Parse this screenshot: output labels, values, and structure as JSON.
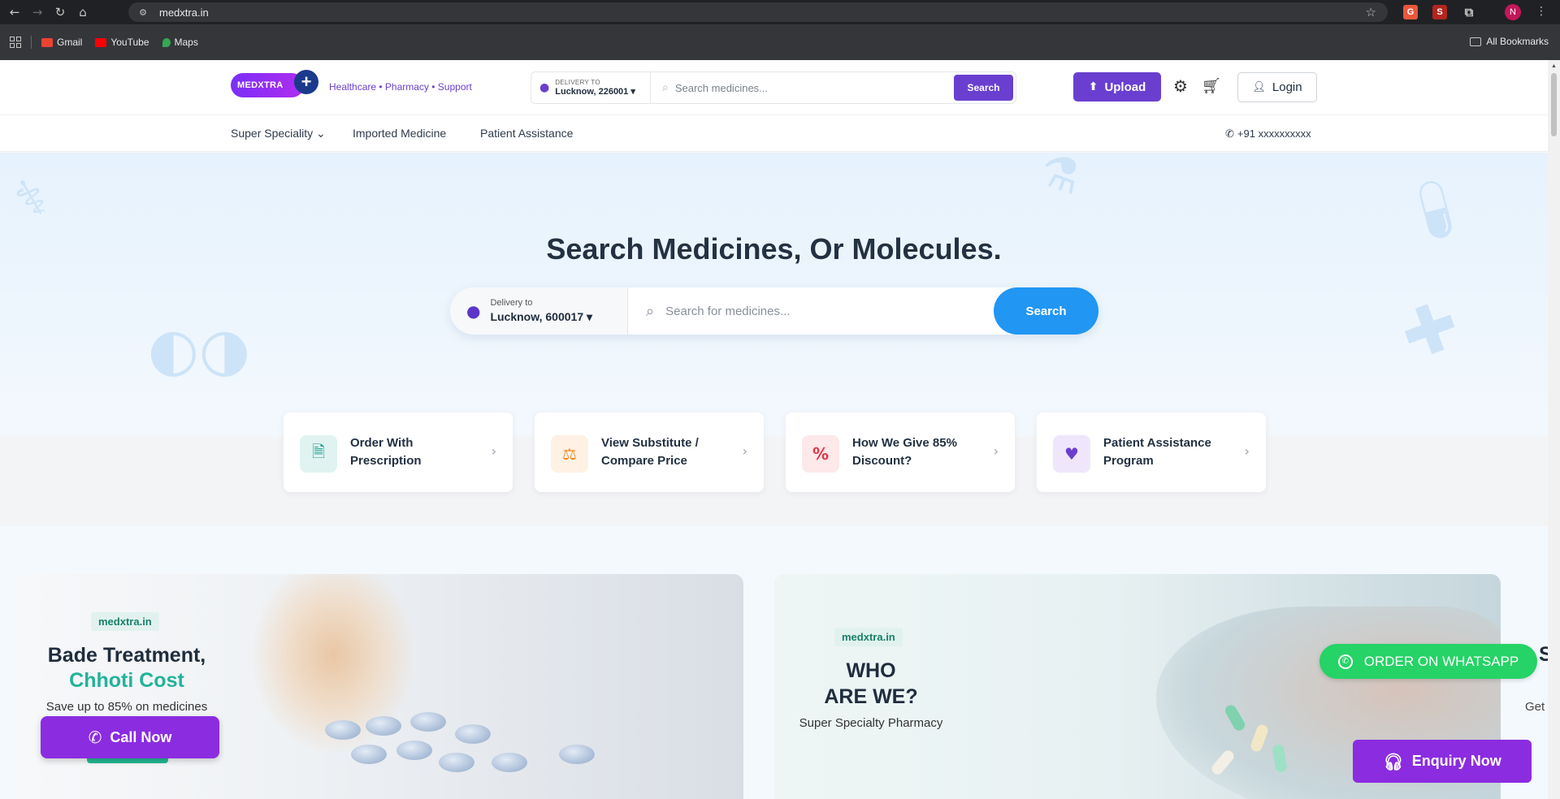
{
  "browser": {
    "url": "medxtra.in",
    "profile_initial": "N",
    "bookmarks": [
      {
        "label": "Gmail",
        "icon": "gmail-icon",
        "color": "#ea4335"
      },
      {
        "label": "YouTube",
        "icon": "youtube-icon",
        "color": "#ff0000"
      },
      {
        "label": "Maps",
        "icon": "maps-icon",
        "color": "#34a853"
      }
    ],
    "all_bookmarks": "All Bookmarks"
  },
  "header": {
    "logo_text": "MEDXTRA",
    "tagline": "Healthcare • Pharmacy • Support",
    "delivery_label": "DELIVERY TO",
    "delivery_value": "Lucknow, 226001 ▾",
    "search_placeholder": "Search medicines...",
    "search_button": "Search",
    "upload_button": "Upload",
    "login_button": "Login"
  },
  "subnav": {
    "items": [
      "Super Speciality ⌄",
      "Imported Medicine",
      "Patient Assistance"
    ],
    "phone": "+91 xxxxxxxxxx"
  },
  "hero": {
    "title": "Search Medicines, Or Molecules.",
    "delivery_label": "Delivery to",
    "delivery_value": "Lucknow, 600017 ▾",
    "search_placeholder": "Search for medicines...",
    "search_button": "Search"
  },
  "quick_links": [
    {
      "label": "Order With Prescription",
      "icon": "prescription-icon",
      "bg": "#e0f3f1",
      "color": "#159a86"
    },
    {
      "label": "View Substitute / Compare Price",
      "icon": "scale-icon",
      "bg": "#fff1e3",
      "color": "#f08a24"
    },
    {
      "label": "How We Give 85% Discount?",
      "icon": "percent-icon",
      "bg": "#fde8ea",
      "color": "#e0394a"
    },
    {
      "label": "Patient Assistance Program",
      "icon": "hand-heart-icon",
      "bg": "#efe6fb",
      "color": "#6a3fd0"
    }
  ],
  "banner_left": {
    "tag": "medxtra.in",
    "title_line1": "Bade Treatment,",
    "title_line2": "Chhoti Cost",
    "subtitle": "Save up to 85% on medicines",
    "call_button": "Call Now"
  },
  "banner_right": {
    "tag": "medxtra.in",
    "title_line1": "WHO",
    "title_line2": "ARE WE?",
    "subtitle": "Super Specialty Pharmacy",
    "peek_title": "S",
    "peek_sub": "Get"
  },
  "floating": {
    "whatsapp": "ORDER ON WHATSAPP",
    "enquiry": "Enquiry Now"
  }
}
